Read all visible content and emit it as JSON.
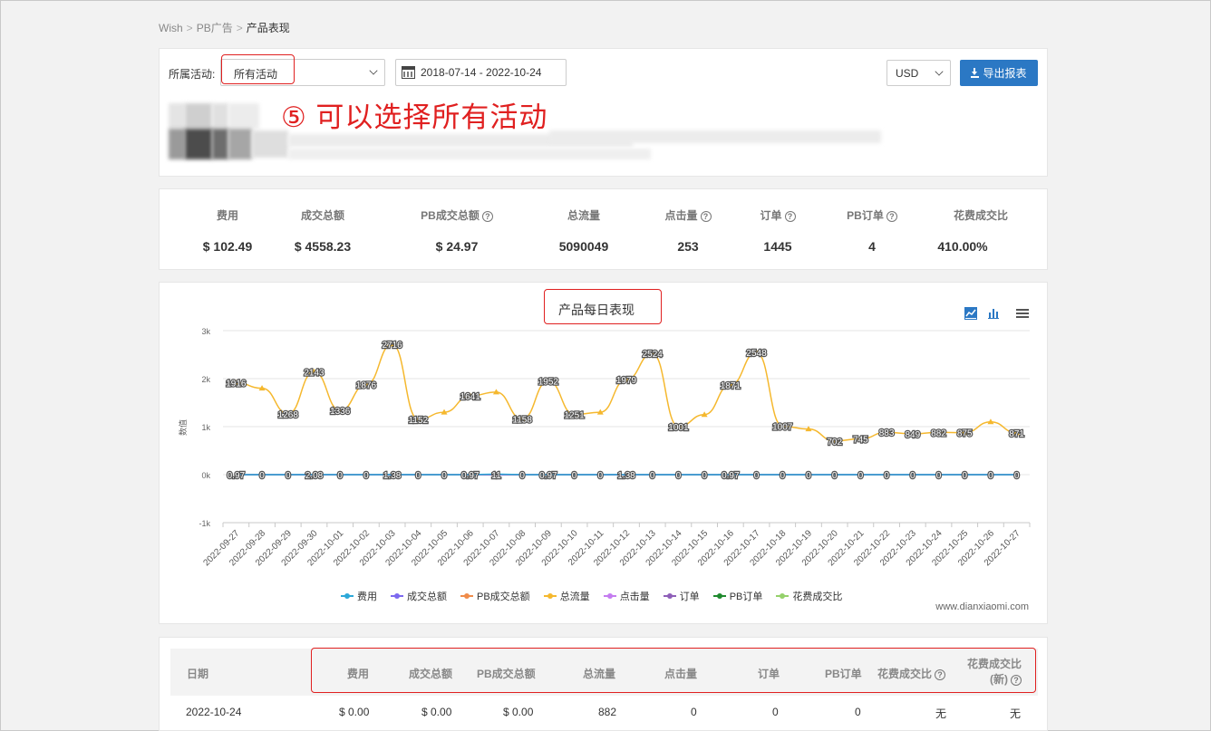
{
  "breadcrumb": {
    "items": [
      "Wish",
      "PB广告",
      "产品表现"
    ]
  },
  "filters": {
    "activity_label": "所属活动:",
    "activity_value": "所有活动",
    "date_range": "2018-07-14 - 2022-10-24",
    "currency": "USD",
    "export_label": "导出报表"
  },
  "annotation": "⑤ 可以选择所有活动",
  "stats": [
    {
      "title": "费用",
      "value": "$ 102.49",
      "help": false
    },
    {
      "title": "成交总额",
      "value": "$ 4558.23",
      "help": false
    },
    {
      "title": "PB成交总额",
      "value": "$ 24.97",
      "help": true
    },
    {
      "title": "总流量",
      "value": "5090049",
      "help": false
    },
    {
      "title": "点击量",
      "value": "253",
      "help": true
    },
    {
      "title": "订单",
      "value": "1445",
      "help": true
    },
    {
      "title": "PB订单",
      "value": "4",
      "help": true
    },
    {
      "title": "花费成交比",
      "value": "410.00%",
      "help": false
    }
  ],
  "chart_data": {
    "type": "line",
    "title": "产品每日表现",
    "ylabel": "数值",
    "ylim": [
      -1000,
      3000
    ],
    "yticks": [
      "-1k",
      "0k",
      "1k",
      "2k",
      "3k"
    ],
    "grid": true,
    "legend_position": "bottom",
    "categories": [
      "2022-09-27",
      "2022-09-28",
      "2022-09-29",
      "2022-09-30",
      "2022-10-01",
      "2022-10-02",
      "2022-10-03",
      "2022-10-04",
      "2022-10-05",
      "2022-10-06",
      "2022-10-07",
      "2022-10-08",
      "2022-10-09",
      "2022-10-10",
      "2022-10-11",
      "2022-10-12",
      "2022-10-13",
      "2022-10-14",
      "2022-10-15",
      "2022-10-16",
      "2022-10-17",
      "2022-10-18",
      "2022-10-19",
      "2022-10-20",
      "2022-10-21",
      "2022-10-22",
      "2022-10-23",
      "2022-10-24",
      "2022-10-25",
      "2022-10-26",
      "2022-10-27"
    ],
    "series": [
      {
        "name": "费用",
        "color": "#2da8d8",
        "values": [
          0.97,
          0,
          0,
          2.08,
          0,
          0,
          1.38,
          0,
          0,
          0.97,
          11,
          0,
          0.97,
          0,
          0,
          1.38,
          0,
          0,
          0,
          0.97,
          0,
          0,
          0,
          0,
          0,
          0,
          0,
          0,
          0,
          0,
          0
        ]
      },
      {
        "name": "成交总额",
        "color": "#7c69ef",
        "values": []
      },
      {
        "name": "PB成交总额",
        "color": "#f08c4a",
        "values": []
      },
      {
        "name": "总流量",
        "color": "#f5b82e",
        "values": [
          1916,
          1800,
          1268,
          2143,
          1336,
          1876,
          2716,
          1152,
          1300,
          1641,
          1720,
          1158,
          1952,
          1251,
          1300,
          1979,
          2524,
          1001,
          1250,
          1871,
          2548,
          1007,
          950,
          702,
          745,
          883,
          849,
          882,
          875,
          1100,
          871
        ],
        "labels": [
          "1916",
          "",
          "1268",
          "2143",
          "1336",
          "1876",
          "2716",
          "1152",
          "",
          "1641",
          "",
          "1158",
          "1952",
          "1251",
          "",
          "1979",
          "2524",
          "1001",
          "",
          "1871",
          "2548",
          "1007",
          "",
          "702",
          "745",
          "883",
          "849",
          "882",
          "875",
          "",
          "871"
        ]
      },
      {
        "name": "点击量",
        "color": "#c47cf0",
        "values": []
      },
      {
        "name": "订单",
        "color": "#8e5fb8",
        "values": []
      },
      {
        "name": "PB订单",
        "color": "#1f8a2e",
        "values": []
      },
      {
        "name": "花费成交比",
        "color": "#95d16b",
        "values": []
      }
    ],
    "zero_labels": [
      "0.97",
      "0",
      "0",
      "2.08",
      "0",
      "0",
      "1.38",
      "0",
      "0",
      "0.97",
      "11",
      "0",
      "0.97",
      "0",
      "0",
      "1.38",
      "0",
      "0",
      "0",
      "0.97",
      "0",
      "0",
      "0",
      "0",
      "0",
      "0",
      "0",
      "0",
      "0",
      "0",
      "0"
    ],
    "watermark": "www.dianxiaomi.com"
  },
  "table": {
    "headers": [
      "日期",
      "费用",
      "成交总额",
      "PB成交总额",
      "总流量",
      "点击量",
      "订单",
      "PB订单",
      "花费成交比",
      "花费成交比(新)"
    ],
    "header_last_line1": "花费成交比",
    "header_last_line2": "(新)",
    "rows": [
      [
        "2022-10-24",
        "$ 0.00",
        "$ 0.00",
        "$ 0.00",
        "882",
        "0",
        "0",
        "0",
        "无",
        "无"
      ]
    ]
  }
}
